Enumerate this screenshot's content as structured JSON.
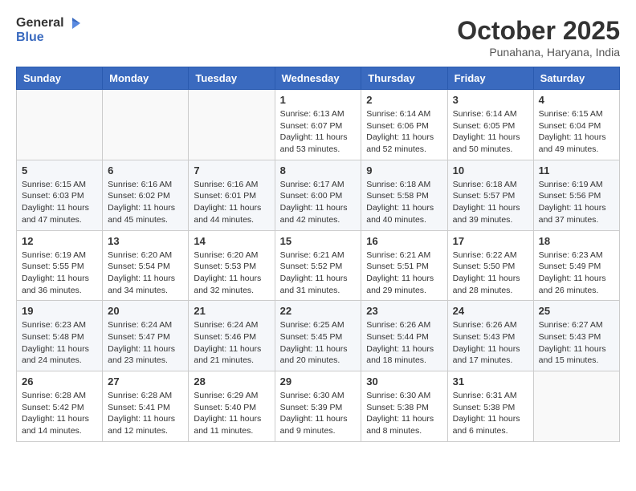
{
  "header": {
    "logo_general": "General",
    "logo_blue": "Blue",
    "month_title": "October 2025",
    "location": "Punahana, Haryana, India"
  },
  "weekdays": [
    "Sunday",
    "Monday",
    "Tuesday",
    "Wednesday",
    "Thursday",
    "Friday",
    "Saturday"
  ],
  "weeks": [
    [
      {
        "day": "",
        "info": ""
      },
      {
        "day": "",
        "info": ""
      },
      {
        "day": "",
        "info": ""
      },
      {
        "day": "1",
        "info": "Sunrise: 6:13 AM\nSunset: 6:07 PM\nDaylight: 11 hours\nand 53 minutes."
      },
      {
        "day": "2",
        "info": "Sunrise: 6:14 AM\nSunset: 6:06 PM\nDaylight: 11 hours\nand 52 minutes."
      },
      {
        "day": "3",
        "info": "Sunrise: 6:14 AM\nSunset: 6:05 PM\nDaylight: 11 hours\nand 50 minutes."
      },
      {
        "day": "4",
        "info": "Sunrise: 6:15 AM\nSunset: 6:04 PM\nDaylight: 11 hours\nand 49 minutes."
      }
    ],
    [
      {
        "day": "5",
        "info": "Sunrise: 6:15 AM\nSunset: 6:03 PM\nDaylight: 11 hours\nand 47 minutes."
      },
      {
        "day": "6",
        "info": "Sunrise: 6:16 AM\nSunset: 6:02 PM\nDaylight: 11 hours\nand 45 minutes."
      },
      {
        "day": "7",
        "info": "Sunrise: 6:16 AM\nSunset: 6:01 PM\nDaylight: 11 hours\nand 44 minutes."
      },
      {
        "day": "8",
        "info": "Sunrise: 6:17 AM\nSunset: 6:00 PM\nDaylight: 11 hours\nand 42 minutes."
      },
      {
        "day": "9",
        "info": "Sunrise: 6:18 AM\nSunset: 5:58 PM\nDaylight: 11 hours\nand 40 minutes."
      },
      {
        "day": "10",
        "info": "Sunrise: 6:18 AM\nSunset: 5:57 PM\nDaylight: 11 hours\nand 39 minutes."
      },
      {
        "day": "11",
        "info": "Sunrise: 6:19 AM\nSunset: 5:56 PM\nDaylight: 11 hours\nand 37 minutes."
      }
    ],
    [
      {
        "day": "12",
        "info": "Sunrise: 6:19 AM\nSunset: 5:55 PM\nDaylight: 11 hours\nand 36 minutes."
      },
      {
        "day": "13",
        "info": "Sunrise: 6:20 AM\nSunset: 5:54 PM\nDaylight: 11 hours\nand 34 minutes."
      },
      {
        "day": "14",
        "info": "Sunrise: 6:20 AM\nSunset: 5:53 PM\nDaylight: 11 hours\nand 32 minutes."
      },
      {
        "day": "15",
        "info": "Sunrise: 6:21 AM\nSunset: 5:52 PM\nDaylight: 11 hours\nand 31 minutes."
      },
      {
        "day": "16",
        "info": "Sunrise: 6:21 AM\nSunset: 5:51 PM\nDaylight: 11 hours\nand 29 minutes."
      },
      {
        "day": "17",
        "info": "Sunrise: 6:22 AM\nSunset: 5:50 PM\nDaylight: 11 hours\nand 28 minutes."
      },
      {
        "day": "18",
        "info": "Sunrise: 6:23 AM\nSunset: 5:49 PM\nDaylight: 11 hours\nand 26 minutes."
      }
    ],
    [
      {
        "day": "19",
        "info": "Sunrise: 6:23 AM\nSunset: 5:48 PM\nDaylight: 11 hours\nand 24 minutes."
      },
      {
        "day": "20",
        "info": "Sunrise: 6:24 AM\nSunset: 5:47 PM\nDaylight: 11 hours\nand 23 minutes."
      },
      {
        "day": "21",
        "info": "Sunrise: 6:24 AM\nSunset: 5:46 PM\nDaylight: 11 hours\nand 21 minutes."
      },
      {
        "day": "22",
        "info": "Sunrise: 6:25 AM\nSunset: 5:45 PM\nDaylight: 11 hours\nand 20 minutes."
      },
      {
        "day": "23",
        "info": "Sunrise: 6:26 AM\nSunset: 5:44 PM\nDaylight: 11 hours\nand 18 minutes."
      },
      {
        "day": "24",
        "info": "Sunrise: 6:26 AM\nSunset: 5:43 PM\nDaylight: 11 hours\nand 17 minutes."
      },
      {
        "day": "25",
        "info": "Sunrise: 6:27 AM\nSunset: 5:43 PM\nDaylight: 11 hours\nand 15 minutes."
      }
    ],
    [
      {
        "day": "26",
        "info": "Sunrise: 6:28 AM\nSunset: 5:42 PM\nDaylight: 11 hours\nand 14 minutes."
      },
      {
        "day": "27",
        "info": "Sunrise: 6:28 AM\nSunset: 5:41 PM\nDaylight: 11 hours\nand 12 minutes."
      },
      {
        "day": "28",
        "info": "Sunrise: 6:29 AM\nSunset: 5:40 PM\nDaylight: 11 hours\nand 11 minutes."
      },
      {
        "day": "29",
        "info": "Sunrise: 6:30 AM\nSunset: 5:39 PM\nDaylight: 11 hours\nand 9 minutes."
      },
      {
        "day": "30",
        "info": "Sunrise: 6:30 AM\nSunset: 5:38 PM\nDaylight: 11 hours\nand 8 minutes."
      },
      {
        "day": "31",
        "info": "Sunrise: 6:31 AM\nSunset: 5:38 PM\nDaylight: 11 hours\nand 6 minutes."
      },
      {
        "day": "",
        "info": ""
      }
    ]
  ]
}
